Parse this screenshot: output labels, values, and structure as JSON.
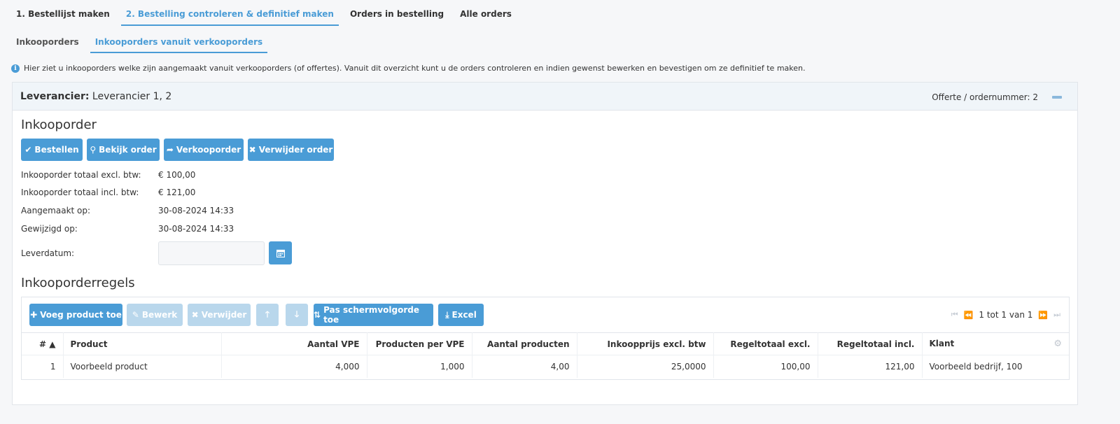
{
  "tabs": [
    "1. Bestellijst maken",
    "2. Bestelling controleren & definitief maken",
    "Orders in bestelling",
    "Alle orders"
  ],
  "subtabs": [
    "Inkooporders",
    "Inkooporders vanuit verkooporders"
  ],
  "info_text": "Hier ziet u inkooporders welke zijn aangemaakt vanuit verkooporders (of offertes). Vanuit dit overzicht kunt u de orders controleren en indien gewenst bewerken en bevestigen om ze definitief te maken.",
  "panel": {
    "supplier_label": "Leverancier:",
    "supplier_value": "Leverancier 1, 2",
    "offer_label": "Offerte / ordernummer: 2"
  },
  "order": {
    "title": "Inkooporder",
    "buttons": {
      "bestellen": "Bestellen",
      "bekijk": "Bekijk order",
      "verkooporder": "Verkooporder",
      "verwijder": "Verwijder order"
    },
    "fields": {
      "total_excl_label": "Inkooporder totaal excl. btw:",
      "total_excl_value": "€ 100,00",
      "total_incl_label": "Inkooporder totaal incl. btw:",
      "total_incl_value": "€ 121,00",
      "created_label": "Aangemaakt op:",
      "created_value": "30-08-2024 14:33",
      "modified_label": "Gewijzigd op:",
      "modified_value": "30-08-2024 14:33",
      "delivery_label": "Leverdatum:",
      "delivery_value": ""
    }
  },
  "lines": {
    "title": "Inkooporderregels",
    "buttons": {
      "add": "Voeg product toe",
      "edit": "Bewerk",
      "delete": "Verwijder",
      "apply_order": "Pas schermvolgorde toe",
      "excel": "Excel"
    },
    "pager": "1 tot 1 van 1",
    "columns": [
      "# ▲",
      "Product",
      "Aantal VPE",
      "Producten per VPE",
      "Aantal producten",
      "Inkoopprijs excl. btw",
      "Regeltotaal excl.",
      "Regeltotaal incl.",
      "Klant"
    ],
    "rows": [
      [
        "1",
        "Voorbeeld product",
        "4,000",
        "1,000",
        "4,00",
        "25,0000",
        "100,00",
        "121,00",
        "Voorbeeld bedrijf, 100"
      ]
    ]
  },
  "colors": {
    "accent": "#4a9cd6",
    "disabled": "#b9d7ec"
  }
}
